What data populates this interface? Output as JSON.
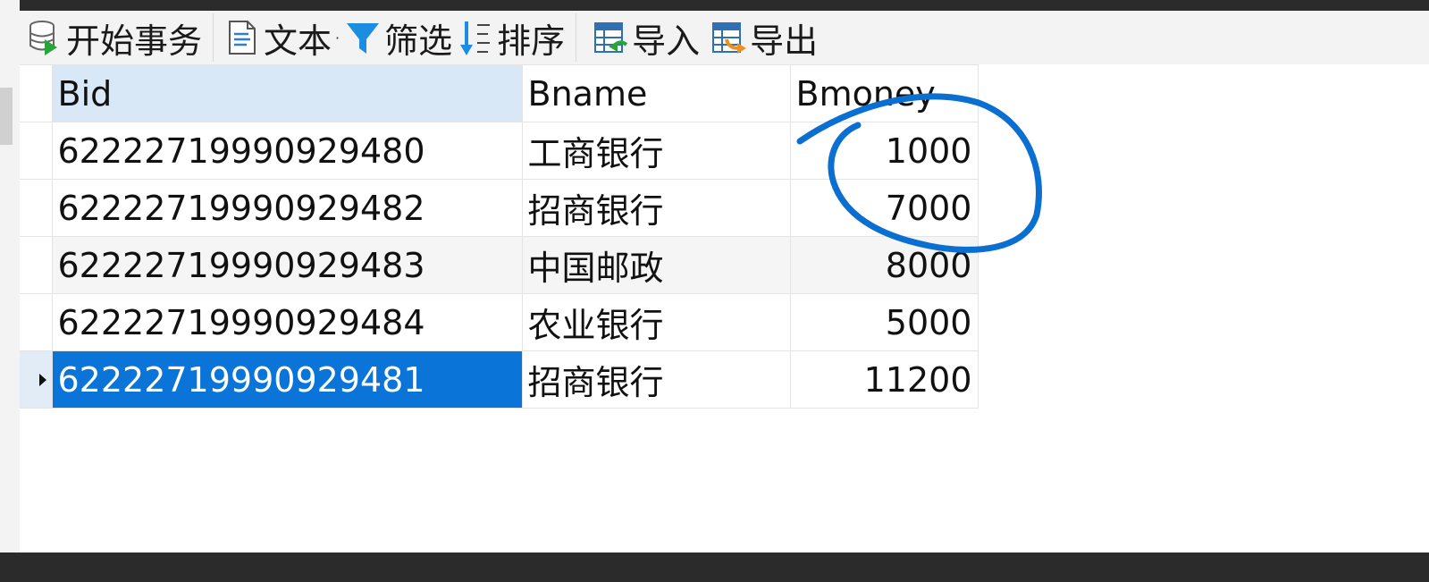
{
  "toolbar": {
    "begin_transaction": "开始事务",
    "text": "文本",
    "filter": "筛选",
    "sort": "排序",
    "import": "导入",
    "export": "导出"
  },
  "columns": [
    "Bid",
    "Bname",
    "Bmoney"
  ],
  "rows": [
    {
      "bid": "62222719990929480",
      "bname": "工商银行",
      "bmoney": "1000"
    },
    {
      "bid": "62222719990929482",
      "bname": "招商银行",
      "bmoney": "7000"
    },
    {
      "bid": "62222719990929483",
      "bname": "中国邮政",
      "bmoney": "8000"
    },
    {
      "bid": "62222719990929484",
      "bname": "农业银行",
      "bmoney": "5000"
    },
    {
      "bid": "62222719990929481",
      "bname": "招商银行",
      "bmoney": "11200"
    }
  ],
  "colors": {
    "selection": "#0a74d8",
    "header_highlight": "#d9e8f6",
    "annotation": "#0a6fd1"
  },
  "icons": {
    "begin_transaction": "database-play-icon",
    "text": "text-document-icon",
    "filter": "funnel-filter-icon",
    "sort": "sort-arrows-icon",
    "import": "table-import-icon",
    "export": "table-export-icon"
  }
}
